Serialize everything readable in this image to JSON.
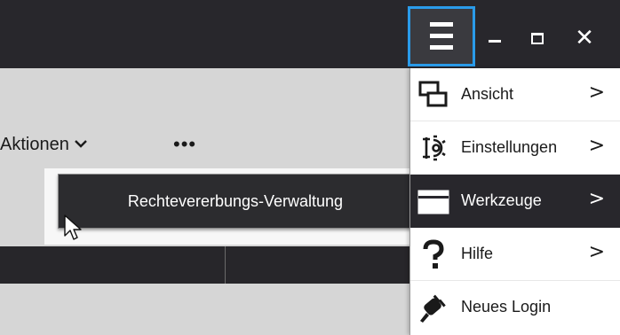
{
  "title_bar": {
    "menu_button_icon": "hamburger-icon",
    "minimize_icon": "minimize-icon",
    "maximize_icon": "maximize-icon",
    "close_icon": "close-icon",
    "minimize_glyph": "",
    "close_glyph": "✕",
    "accent_color": "#2a9bea",
    "background_color": "#28272c"
  },
  "toolbar": {
    "actions_label": "Aktionen",
    "actions_chevron": "⌄",
    "more_label": "•••"
  },
  "context_menu": {
    "item_label": "Rechtevererbungs-Verwaltung"
  },
  "main_menu": {
    "items": [
      {
        "label": "Ansicht",
        "icon": "window-layout-icon",
        "arrow": ">",
        "active": false
      },
      {
        "label": "Einstellungen",
        "icon": "settings-icon",
        "arrow": ">",
        "active": false
      },
      {
        "label": "Werkzeuge",
        "icon": "toolbox-icon",
        "arrow": ">",
        "active": true
      },
      {
        "label": "Hilfe",
        "icon": "help-icon",
        "arrow": ">",
        "active": false
      },
      {
        "label": "Neues Login",
        "icon": "plug-icon",
        "arrow": "",
        "active": false
      }
    ]
  }
}
